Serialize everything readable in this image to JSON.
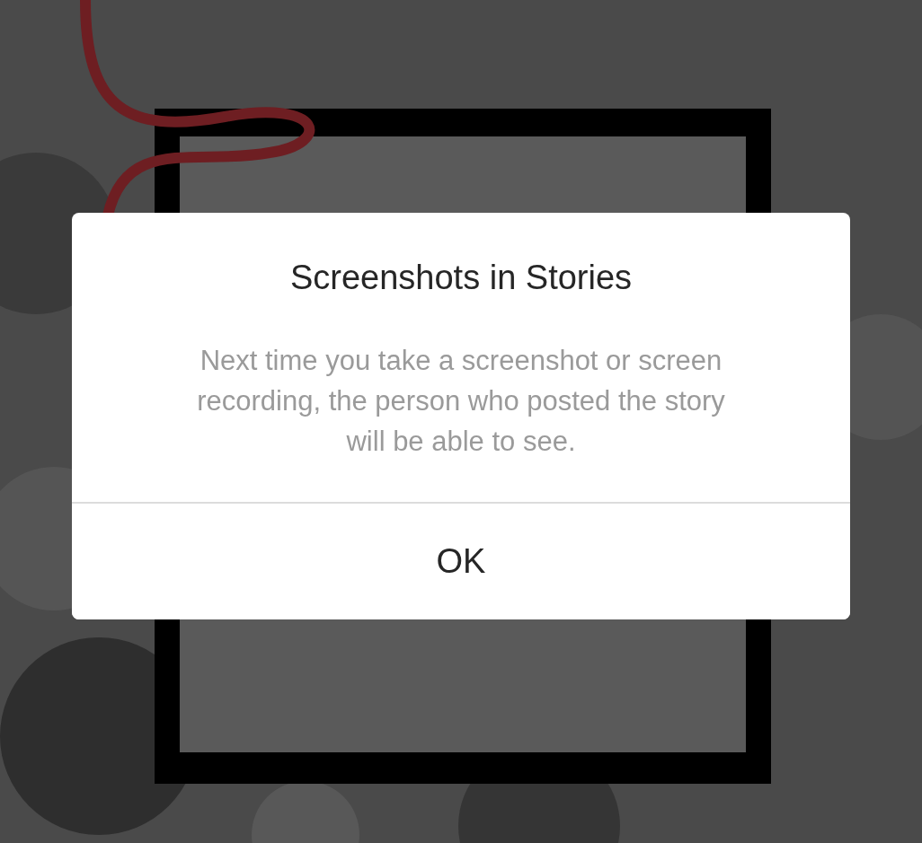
{
  "alert": {
    "title": "Screenshots in Stories",
    "message": "Next time you take a screenshot or screen recording, the person who posted the story will be able to see.",
    "buttons": [
      "OK"
    ]
  }
}
